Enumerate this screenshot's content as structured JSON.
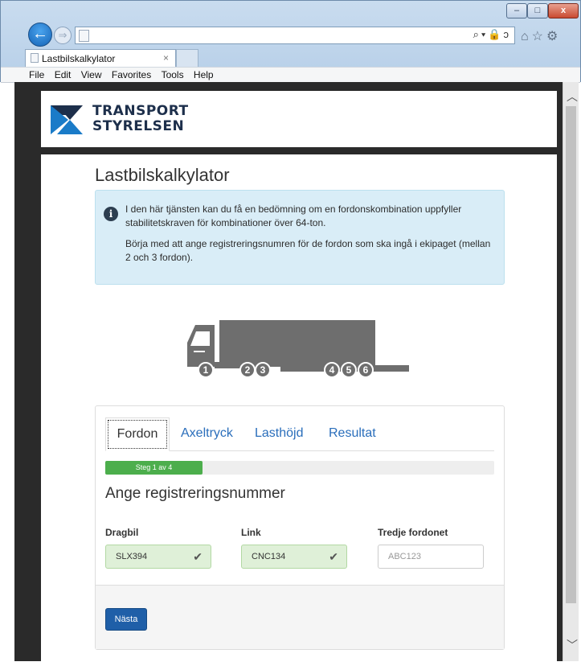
{
  "browser": {
    "window_buttons": {
      "minimize": "–",
      "maximize": "□",
      "close": "x"
    },
    "back_glyph": "←",
    "forward_glyph": "⇒",
    "address_tools": "⌕▾🔒ↄ",
    "toolbar_icons": "⌂☆⚙",
    "tab": {
      "label": "Lastbilskalkylator",
      "close": "×"
    },
    "menu": [
      "File",
      "Edit",
      "View",
      "Favorites",
      "Tools",
      "Help"
    ]
  },
  "scrollbar": {
    "up": "︿",
    "down": "﹀"
  },
  "header": {
    "logo_line1": "TRANSPORT",
    "logo_line2": "STYRELSEN",
    "colors": {
      "brand": "#1a7bc8",
      "text": "#1d2f4b"
    }
  },
  "page": {
    "title": "Lastbilskalkylator",
    "info": {
      "icon": "i",
      "p1": "I den här tjänsten kan du få en bedömning om en fordonskombination uppfyller stabilitetskraven för kombinationer över 64-ton.",
      "p2": "Börja med att ange registreringsnumren för de fordon som ska ingå i ekipaget (mellan 2 och 3 fordon)."
    },
    "axles": [
      "1",
      "2",
      "3",
      "4",
      "5",
      "6"
    ]
  },
  "form": {
    "tabs": [
      "Fordon",
      "Axeltryck",
      "Lasthöjd",
      "Resultat"
    ],
    "progress": {
      "label": "Steg 1 av 4",
      "percent": 25
    },
    "section_title": "Ange registreringsnummer",
    "fields": [
      {
        "label": "Dragbil",
        "value": "SLX394",
        "placeholder": "",
        "valid": true
      },
      {
        "label": "Link",
        "value": "CNC134",
        "placeholder": "",
        "valid": true
      },
      {
        "label": "Tredje fordonet",
        "value": "",
        "placeholder": "ABC123",
        "valid": false
      }
    ],
    "check_glyph": "✔",
    "next_label": "Nästa"
  }
}
